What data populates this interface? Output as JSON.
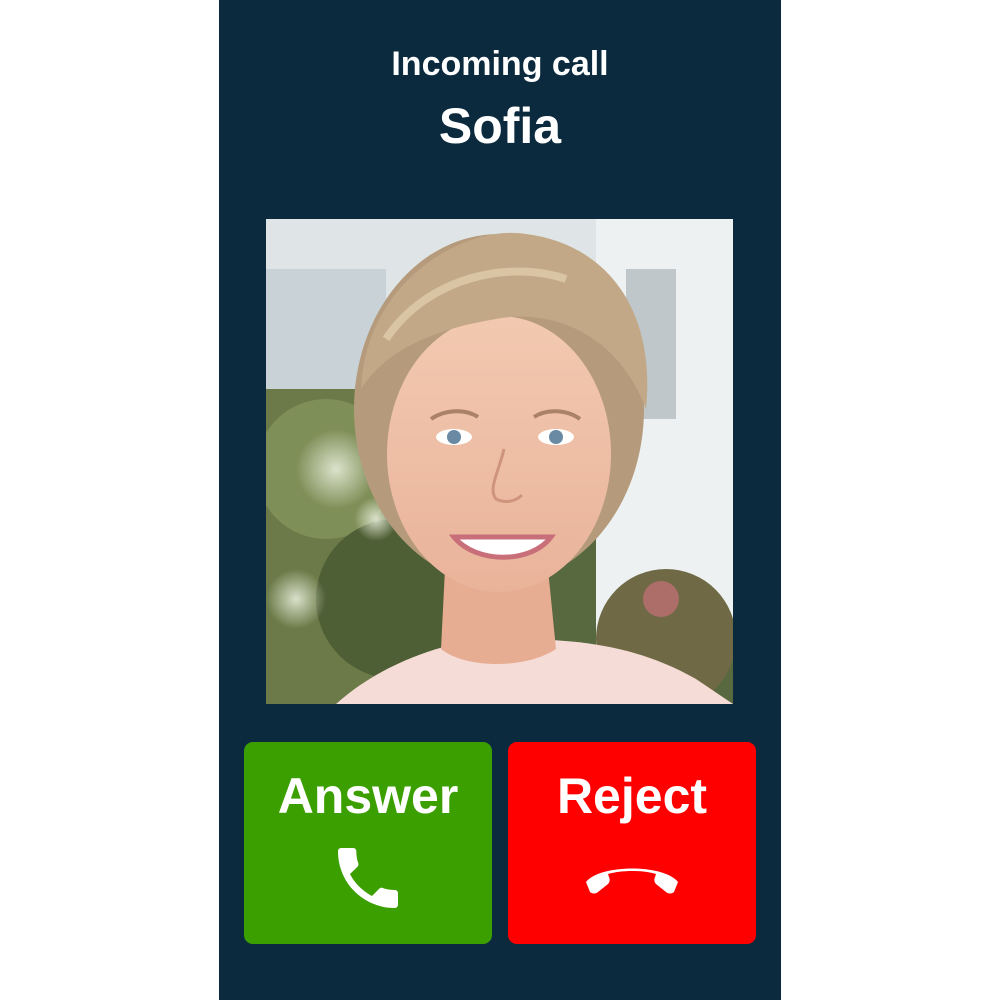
{
  "call": {
    "status_label": "Incoming call",
    "caller_name": "Sofia"
  },
  "photo": {
    "icon": "caller-photo"
  },
  "actions": {
    "answer": {
      "label": "Answer",
      "icon": "phone-icon",
      "color": "#3c9f00"
    },
    "reject": {
      "label": "Reject",
      "icon": "hang-up-icon",
      "color": "#ff0000"
    }
  },
  "theme": {
    "background": "#0b2a3e",
    "text": "#ffffff"
  }
}
